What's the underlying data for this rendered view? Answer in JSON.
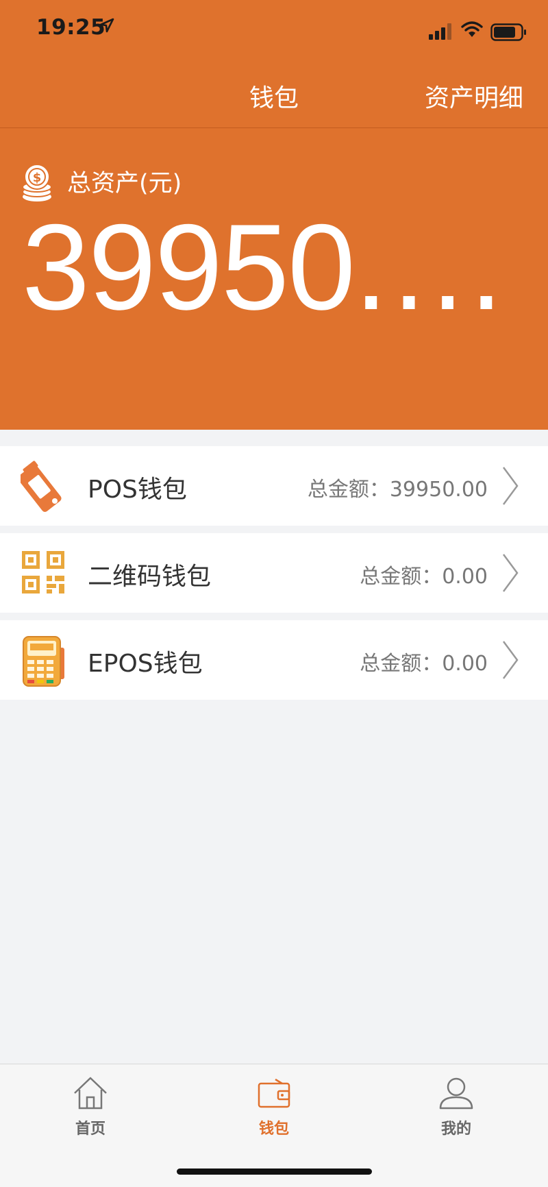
{
  "status_bar": {
    "time": "19:25"
  },
  "nav": {
    "title": "钱包",
    "right_action": "资产明细"
  },
  "assets": {
    "label": "总资产(元)",
    "value": "39950.…"
  },
  "wallets": [
    {
      "name": "POS钱包",
      "amount": "总金额：39950.00",
      "icon": "pos-terminal-icon"
    },
    {
      "name": "二维码钱包",
      "amount": "总金额：0.00",
      "icon": "qr-code-icon"
    },
    {
      "name": "EPOS钱包",
      "amount": "总金额：0.00",
      "icon": "card-reader-icon"
    }
  ],
  "tabbar": {
    "items": [
      {
        "label": "首页",
        "icon": "home-icon",
        "active": false
      },
      {
        "label": "钱包",
        "icon": "wallet-icon",
        "active": true
      },
      {
        "label": "我的",
        "icon": "user-icon",
        "active": false
      }
    ]
  },
  "colors": {
    "accent": "#df722d",
    "background": "#f2f3f5"
  }
}
